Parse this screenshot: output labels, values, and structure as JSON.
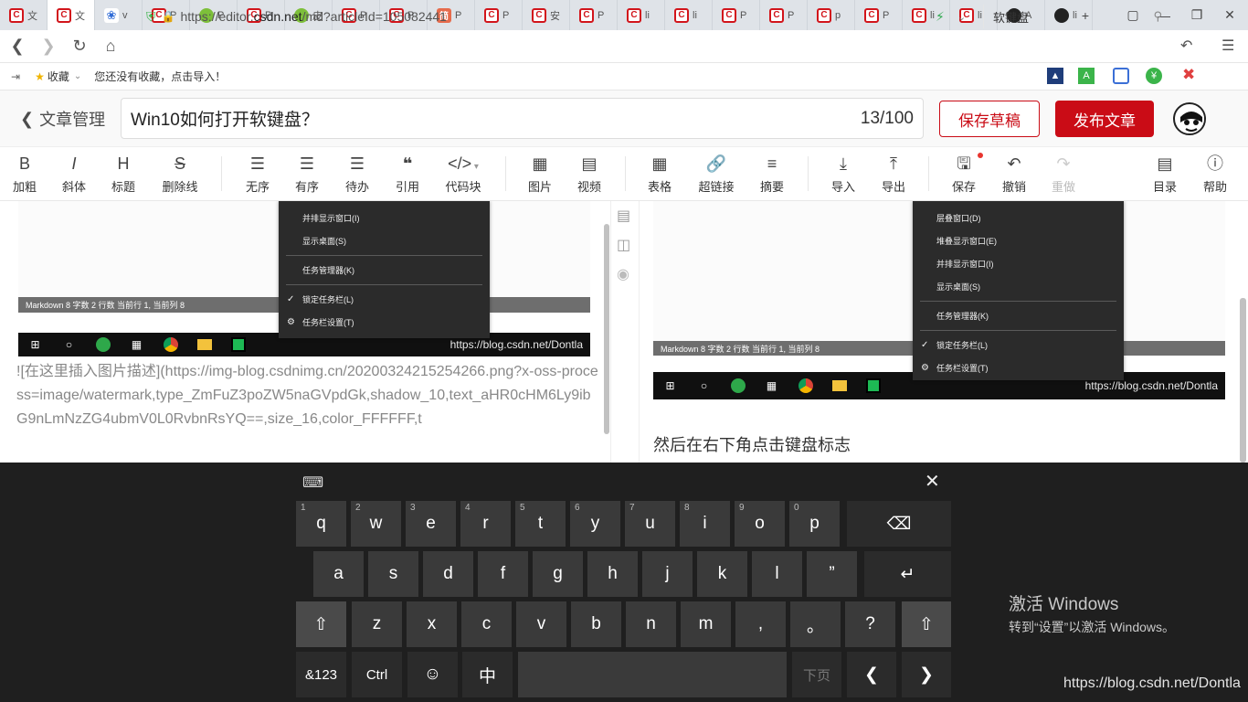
{
  "browser": {
    "tabs": [
      {
        "label": "文",
        "icon": "csdn"
      },
      {
        "label": "文",
        "icon": "csdn",
        "active": true
      },
      {
        "label": "v",
        "icon": "paw"
      },
      {
        "label": "P",
        "icon": "csdn"
      },
      {
        "label": "P",
        "icon": "green"
      },
      {
        "label": "P",
        "icon": "csdn"
      },
      {
        "label": "皮",
        "icon": "green"
      },
      {
        "label": "P",
        "icon": "csdn"
      },
      {
        "label": "P",
        "icon": "csdn"
      },
      {
        "label": "P",
        "icon": "jian",
        "glyph": "简"
      },
      {
        "label": "P",
        "icon": "csdn"
      },
      {
        "label": "安",
        "icon": "csdn"
      },
      {
        "label": "P",
        "icon": "csdn"
      },
      {
        "label": "li",
        "icon": "csdn"
      },
      {
        "label": "li",
        "icon": "csdn"
      },
      {
        "label": "P",
        "icon": "csdn"
      },
      {
        "label": "P",
        "icon": "csdn"
      },
      {
        "label": "p",
        "icon": "csdn"
      },
      {
        "label": "P",
        "icon": "csdn"
      },
      {
        "label": "li",
        "icon": "csdn"
      },
      {
        "label": "li",
        "icon": "csdn"
      },
      {
        "label": "A",
        "icon": "gh"
      },
      {
        "label": "li",
        "icon": "gh"
      }
    ],
    "url_prefix": "https://editor.",
    "url_domain": "csdn.net",
    "url_suffix": "/md?articleId=105082441",
    "search_text": "软键盘",
    "favorites_label": "收藏",
    "favorites_hint": "您还没有收藏，点击导入！"
  },
  "editor": {
    "back_label": "文章管理",
    "title": "Win10如何打开软键盘？",
    "title_count": "13/100",
    "save_draft": "保存草稿",
    "publish": "发布文章"
  },
  "toolbar": {
    "bold": "加粗",
    "italic": "斜体",
    "heading": "标题",
    "strike": "删除线",
    "ul": "无序",
    "ol": "有序",
    "todo": "待办",
    "quote": "引用",
    "code": "代码块",
    "image": "图片",
    "video": "视频",
    "table": "表格",
    "link": "超链接",
    "summary": "摘要",
    "import": "导入",
    "export": "导出",
    "save": "保存",
    "undo": "撤销",
    "redo": "重做",
    "toc": "目录",
    "help": "帮助"
  },
  "left": {
    "menu": [
      "并排显示窗口(I)",
      "显示桌面(S)",
      "任务管理器(K)",
      "锁定任务栏(L)",
      "任务栏设置(T)"
    ],
    "status": "Markdown   8 字数   2 行数   当前行 1, 当前列 8",
    "taskbar_watermark": "https://blog.csdn.net/Dontla",
    "markdown_text": "![在这里插入图片描述](https://img-blog.csdnimg.cn/20200324215254266.png?x-oss-process=image/watermark,type_ZmFuZ3poZW5naGVpdGk,shadow_10,text_aHR0cHM6Ly9ibG9nLmNzZG4ubmV0L0RvbnRsYQ==,size_16,color_FFFFFF,t"
  },
  "right": {
    "menu": [
      "层叠窗口(D)",
      "堆叠显示窗口(E)",
      "并排显示窗口(I)",
      "显示桌面(S)",
      "任务管理器(K)",
      "锁定任务栏(L)",
      "任务栏设置(T)"
    ],
    "status": "Markdown   8 字数   2 行数   当前行 1, 当前列 8",
    "taskbar_watermark": "https://blog.csdn.net/Dontla",
    "paragraph": "然后在右下角点击键盘标志"
  },
  "keyboard": {
    "row1": [
      [
        "q",
        "1"
      ],
      [
        "w",
        "2"
      ],
      [
        "e",
        "3"
      ],
      [
        "r",
        "4"
      ],
      [
        "t",
        "5"
      ],
      [
        "y",
        "6"
      ],
      [
        "u",
        "7"
      ],
      [
        "i",
        "8"
      ],
      [
        "o",
        "9"
      ],
      [
        "p",
        "0"
      ]
    ],
    "row2": [
      "a",
      "s",
      "d",
      "f",
      "g",
      "h",
      "j",
      "k",
      "l",
      "”"
    ],
    "row3": [
      "z",
      "x",
      "c",
      "v",
      "b",
      "n",
      "m",
      ",",
      "。",
      "?"
    ],
    "sym": "&123",
    "ctrl": "Ctrl",
    "zh": "中",
    "next_page": "下页"
  },
  "activation": {
    "title": "激活 Windows",
    "subtitle": "转到“设置”以激活 Windows。"
  },
  "watermark": "https://blog.csdn.net/Dontla",
  "colors": {
    "brand": "#ca0c16",
    "keyboard_bg": "#1f1f1f",
    "key": "#3a3a3a"
  }
}
